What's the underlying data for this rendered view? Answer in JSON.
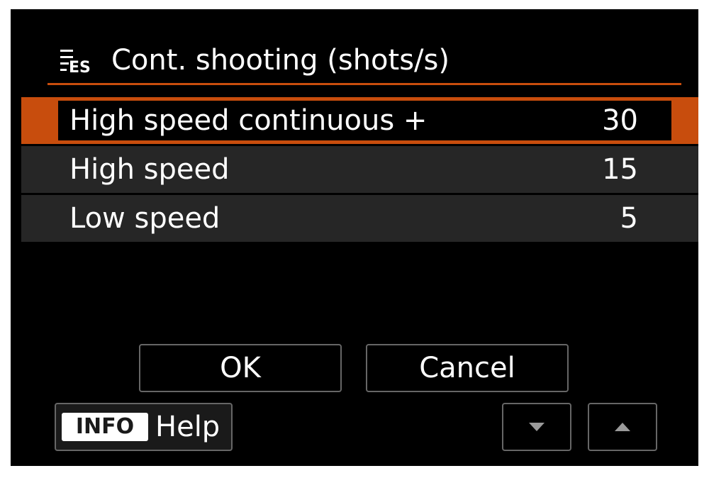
{
  "header": {
    "icon": "movie-shooting-icon",
    "title": "Cont. shooting (shots/s)"
  },
  "options": [
    {
      "label": "High speed continuous +",
      "value": "30",
      "selected": true
    },
    {
      "label": "High speed",
      "value": "15",
      "selected": false
    },
    {
      "label": "Low speed",
      "value": "5",
      "selected": false
    }
  ],
  "buttons": {
    "ok_label": "OK",
    "cancel_label": "Cancel"
  },
  "footer": {
    "info_label": "INFO",
    "help_label": "Help",
    "down_icon": "triangle-down-icon",
    "up_icon": "triangle-up-icon"
  },
  "colors": {
    "accent": "#c84d0d",
    "background": "#000000",
    "row_background": "#262626",
    "text": "#ffffff",
    "border": "#666666"
  }
}
